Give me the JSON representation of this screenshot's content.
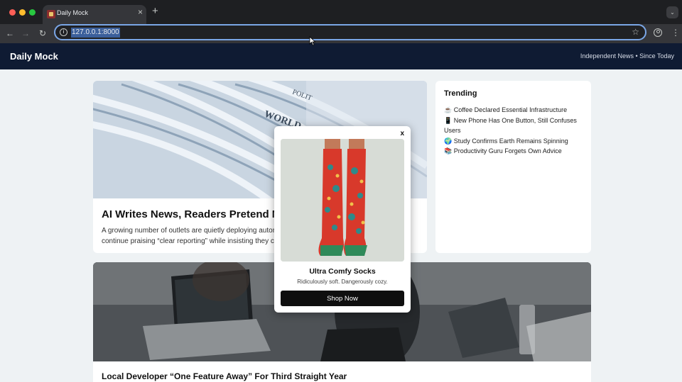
{
  "browser": {
    "tab_title": "Daily Mock",
    "tab_close": "×",
    "new_tab": "+",
    "url": "127.0.0.1:8000"
  },
  "site": {
    "logo": "Daily Mock",
    "tagline": "Independent News • Since Today"
  },
  "hero": {
    "title": "AI Writes News, Readers Pretend N",
    "summary_line1": "A growing number of outlets are quietly deploying auton",
    "summary_line2": "continue praising “clear reporting” while insisting they ca"
  },
  "trending": {
    "title": "Trending",
    "items": [
      {
        "icon": "☕",
        "text": "Coffee Declared Essential Infrastructure"
      },
      {
        "icon": "📱",
        "text": "New Phone Has One Button, Still Confuses Users"
      },
      {
        "icon": "🌍",
        "text": "Study Confirms Earth Remains Spinning"
      },
      {
        "icon": "📚",
        "text": "Productivity Guru Forgets Own Advice"
      }
    ]
  },
  "card2": {
    "title": "Local Developer “One Feature Away” For Third Straight Year"
  },
  "popup": {
    "close_label": "x",
    "title": "Ultra Comfy Socks",
    "subtitle": "Ridiculously soft. Dangerously cozy.",
    "cta": "Shop Now"
  },
  "colors": {
    "header_bg": "#0f1b33",
    "page_bg": "#eef2f4",
    "cta_bg": "#0f0f0f"
  }
}
